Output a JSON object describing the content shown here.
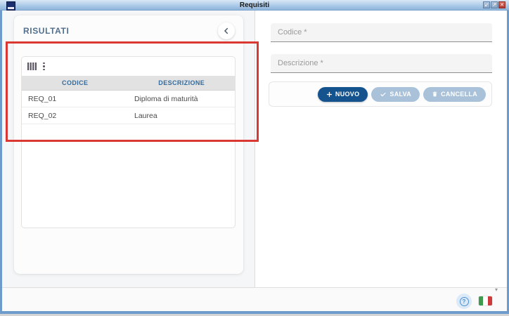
{
  "window": {
    "title": "Requisiti",
    "controls": [
      {
        "name": "minimize-button",
        "glyph": "↙"
      },
      {
        "name": "maximize-button",
        "glyph": "↗"
      },
      {
        "name": "close-button",
        "glyph": "✕"
      }
    ]
  },
  "results_panel": {
    "title": "RISULTATI",
    "table": {
      "columns": [
        "CODICE",
        "DESCRIZIONE"
      ],
      "rows": [
        {
          "codice": "REQ_01",
          "descrizione": "Diploma di maturità"
        },
        {
          "codice": "REQ_02",
          "descrizione": "Laurea"
        }
      ]
    }
  },
  "form": {
    "codice_placeholder": "Codice *",
    "descrizione_placeholder": "Descrizione *",
    "buttons": {
      "nuovo": "NUOVO",
      "salva": "SALVA",
      "cancella": "CANCELLA"
    }
  },
  "footer": {
    "help": "?"
  },
  "colors": {
    "primary_button": "#15538f",
    "disabled_button": "#a9c2d9",
    "table_header_text": "#336b9e",
    "panel_title": "#52708e",
    "annotation_rectangle": "#da3832",
    "titlebar_top": "#dae8f7",
    "titlebar_bottom": "#8fb4da"
  }
}
